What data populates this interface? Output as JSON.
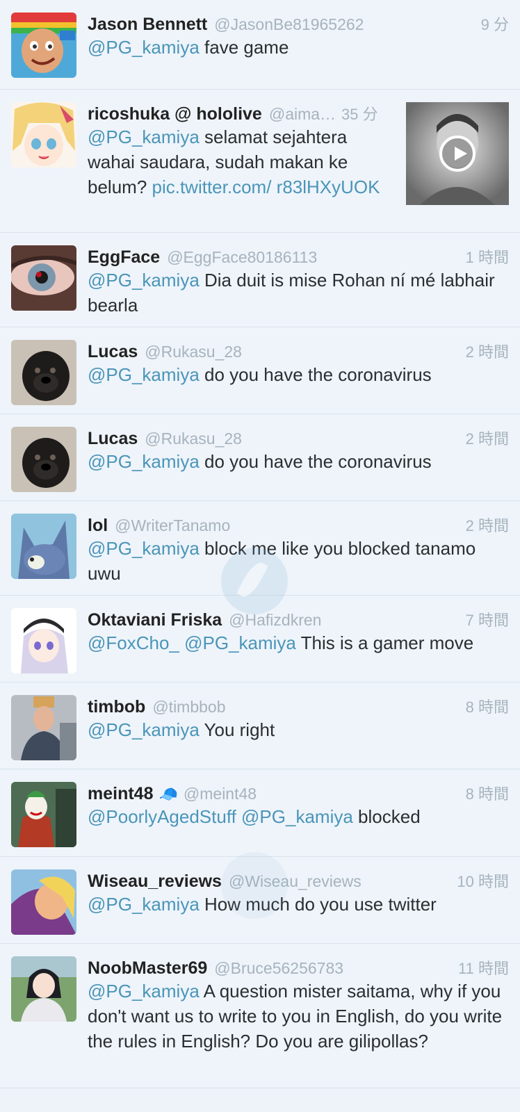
{
  "tweets": [
    {
      "name": "Jason Bennett",
      "handle": "@JasonBe81965262",
      "time": "9 分",
      "mentions": "@PG_kamiya",
      "text": " fave game"
    },
    {
      "name": "ricoshuka @ hololive",
      "handle": "@aima…",
      "time": "35 分",
      "mentions": "@PG_kamiya",
      "text": " selamat sejahtera wahai saudara, sudah makan ke belum? ",
      "link": "pic.twitter.com/ r83lHXyUOK"
    },
    {
      "name": "EggFace",
      "handle": "@EggFace80186113",
      "time": "1 時間",
      "mentions": "@PG_kamiya",
      "text": " Dia duit is mise Rohan ní mé labhair bearla"
    },
    {
      "name": "Lucas",
      "handle": "@Rukasu_28",
      "time": "2 時間",
      "mentions": "@PG_kamiya",
      "text": " do you have the coronavirus"
    },
    {
      "name": "Lucas",
      "handle": "@Rukasu_28",
      "time": "2 時間",
      "mentions": "@PG_kamiya",
      "text": " do you have the coronavirus"
    },
    {
      "name": "lol",
      "handle": "@WriterTanamo",
      "time": "2 時間",
      "mentions": "@PG_kamiya",
      "text": " block me like you blocked tanamo uwu"
    },
    {
      "name": "Oktaviani Friska",
      "handle": "@Hafizdkren",
      "time": "7 時間",
      "mentions": "@FoxCho_ @PG_kamiya",
      "text": " This is a gamer move"
    },
    {
      "name": "timbob",
      "handle": "@timbbob",
      "time": "8 時間",
      "mentions": "@PG_kamiya",
      "text": " You right"
    },
    {
      "name": "meint48",
      "badge": "🧢",
      "handle": "@meint48",
      "time": "8 時間",
      "mentions": "@PoorlyAgedStuff @PG_kamiya",
      "text": " blocked"
    },
    {
      "name": "Wiseau_reviews",
      "handle": "@Wiseau_reviews",
      "time": "10 時間",
      "mentions": "@PG_kamiya",
      "text": " How much do you use twitter"
    },
    {
      "name": "NoobMaster69",
      "handle": "@Bruce56256783",
      "time": "11 時間",
      "mentions": "@PG_kamiya",
      "text": " A question mister saitama, why if you don't want us to write to you in English, do you write the rules in English? Do you are gilipollas?"
    }
  ],
  "colors": {
    "mention": "#4b95b8",
    "meta": "#a7b3bd",
    "background": "#edf3f9"
  },
  "icons": {
    "media_play": "play-icon",
    "watermark": "feather-icon"
  }
}
